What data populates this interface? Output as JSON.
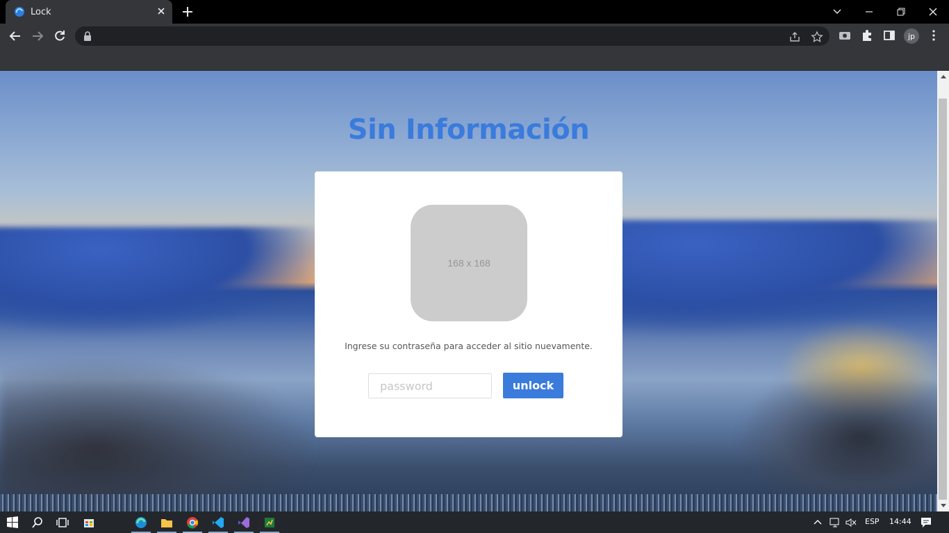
{
  "browser": {
    "tab_title": "Lock",
    "address": "",
    "avatar_initials": "jp"
  },
  "page": {
    "title": "Sin Información",
    "image_placeholder": "168 x 168",
    "message": "Ingrese su contraseña para acceder al sitio nuevamente.",
    "password_placeholder": "password",
    "password_value": "",
    "unlock_label": "unlock"
  },
  "taskbar": {
    "language": "ESP",
    "time": "14:44"
  },
  "colors": {
    "accent": "#3a7bdc",
    "card": "#ffffff",
    "placeholder_bg": "#cccccc"
  }
}
